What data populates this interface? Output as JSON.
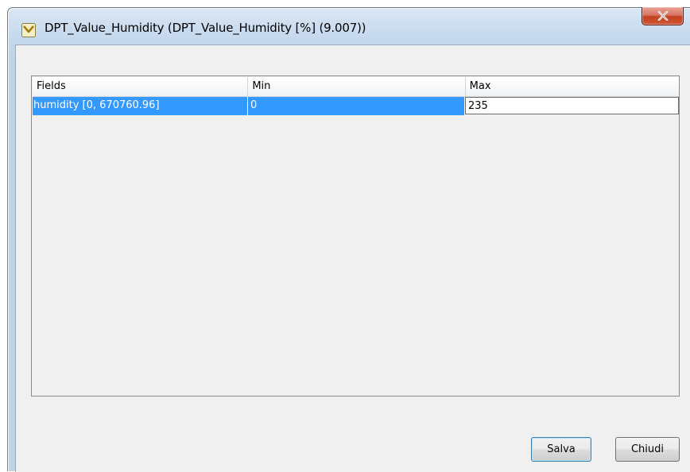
{
  "window": {
    "title": "DPT_Value_Humidity (DPT_Value_Humidity [%] (9.007))",
    "app_icon": "app-shield-icon",
    "close_icon": "close-icon"
  },
  "table": {
    "columns": [
      "Fields",
      "Min",
      "Max"
    ],
    "rows": [
      {
        "field": "humidity [0, 670760.96]",
        "min": "0",
        "max": "235",
        "selected": true
      }
    ]
  },
  "buttons": {
    "save_label": "Salva",
    "close_label": "Chiudi"
  },
  "colors": {
    "selection": "#3399ff",
    "close_button": "#c3401f"
  }
}
